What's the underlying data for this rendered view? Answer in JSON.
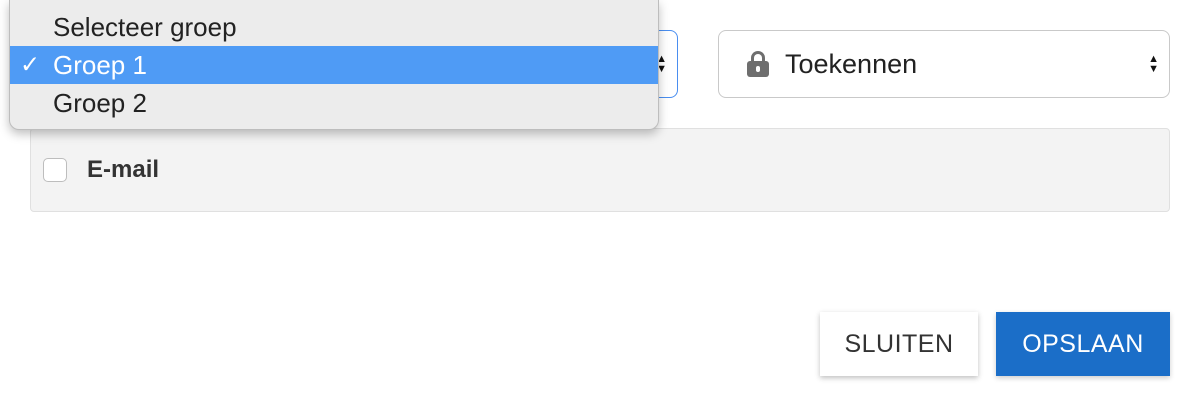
{
  "group_select": {
    "options": [
      "Selecteer groep",
      "Groep 1",
      "Groep 2"
    ],
    "selected": "Groep 1",
    "open": true
  },
  "permission_select": {
    "icon": "lock-icon",
    "value": "Toekennen"
  },
  "email_option": {
    "label": "E-mail",
    "checked": false
  },
  "buttons": {
    "close_label": "SLUITEN",
    "save_label": "OPSLAAN"
  },
  "colors": {
    "accent": "#1b6ec8",
    "dropdown_highlight": "#4f9bf5",
    "focus_border": "#4a8ef0"
  }
}
